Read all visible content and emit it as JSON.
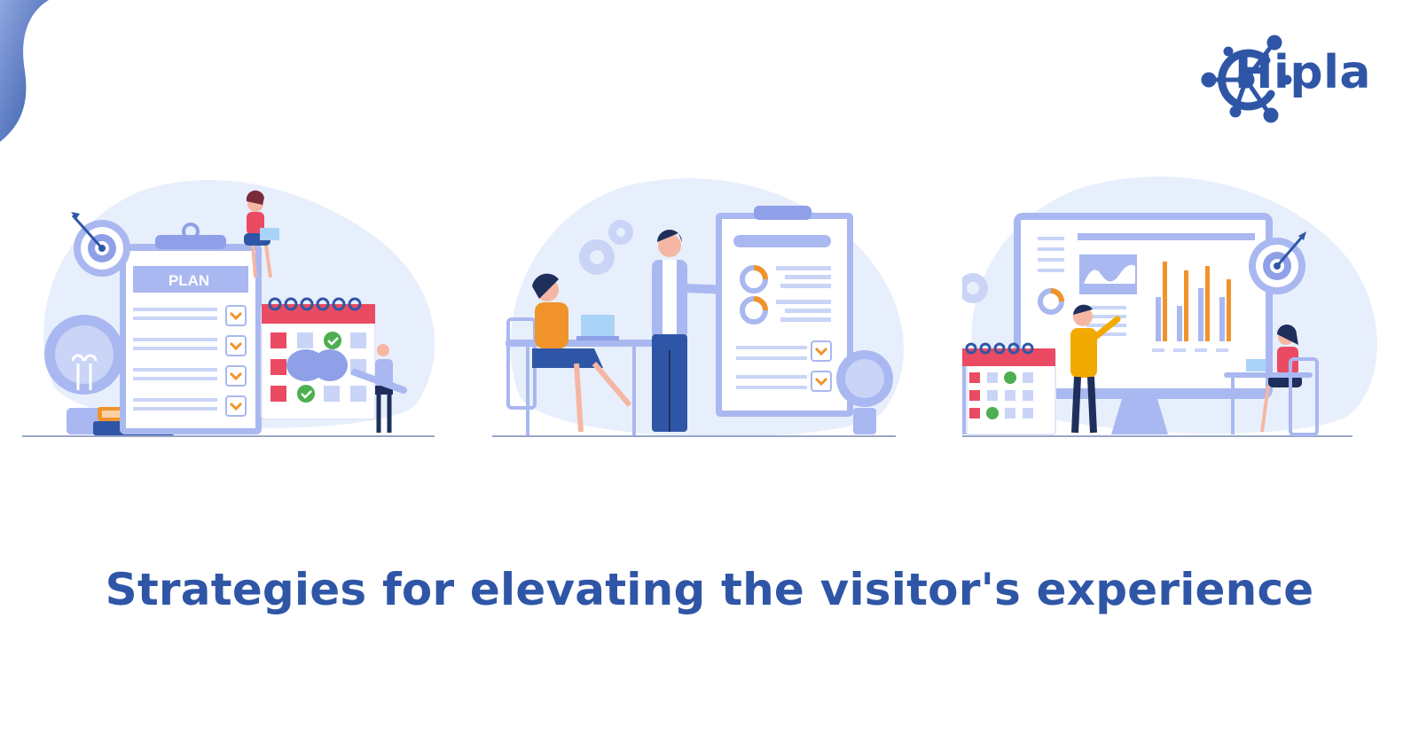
{
  "brand": {
    "name": "Hipla",
    "color": "#2f56a6"
  },
  "headline": "Strategies for elevating the visitor's experience",
  "plan_label": "PLAN",
  "illustrations": [
    {
      "id": "planning-scene",
      "icons": [
        "target-icon",
        "clipboard-icon",
        "calendar-icon",
        "lightbulb-icon",
        "books-icon",
        "person-icon"
      ]
    },
    {
      "id": "meeting-scene",
      "icons": [
        "gear-icon",
        "clipboard-icon",
        "lightbulb-icon",
        "laptop-icon",
        "person-icon"
      ]
    },
    {
      "id": "analytics-scene",
      "icons": [
        "monitor-icon",
        "bar-chart-icon",
        "calendar-icon",
        "target-icon",
        "gear-icon",
        "person-icon"
      ]
    }
  ],
  "colors": {
    "primary": "#2f56a6",
    "light_blue": "#a9b8f0",
    "pale_blue": "#e8effc",
    "orange": "#f0932b",
    "red": "#ea4b62",
    "green": "#4caf50"
  }
}
